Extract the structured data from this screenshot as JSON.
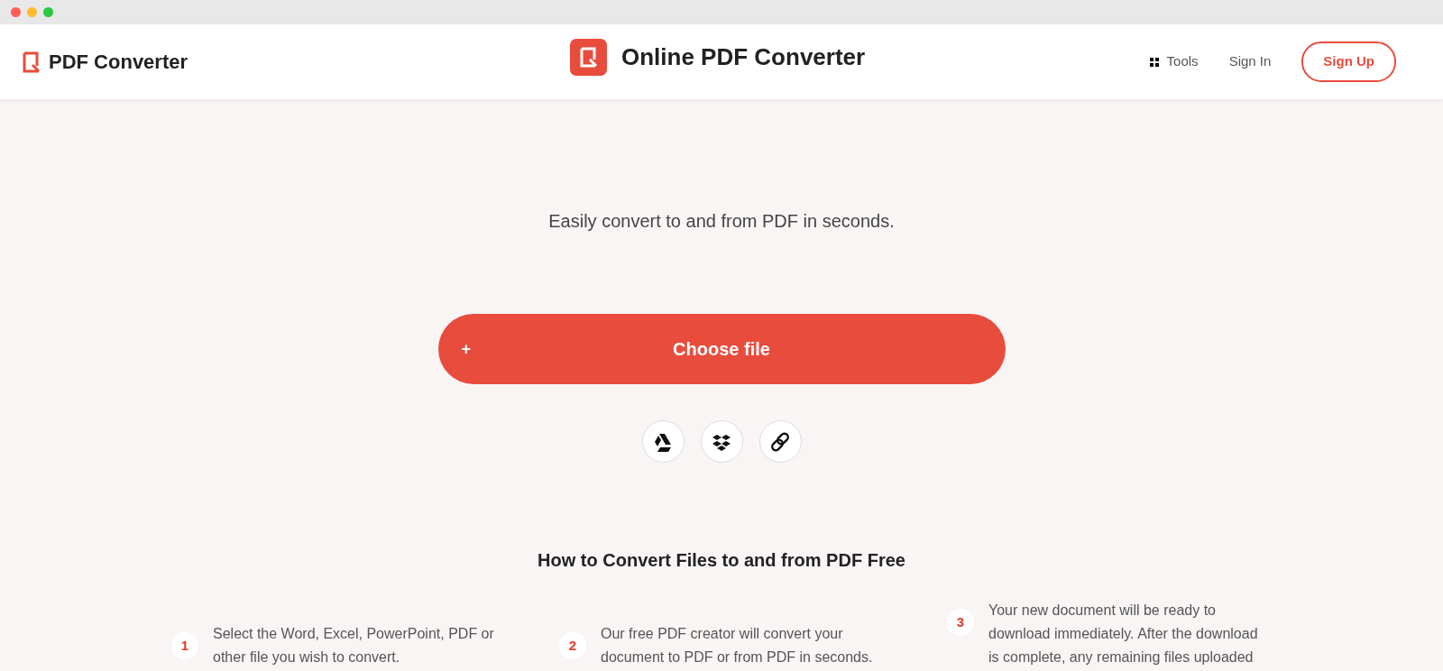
{
  "brand": {
    "name": "PDF Converter"
  },
  "header": {
    "title": "Online PDF Converter"
  },
  "nav": [
    {
      "label": "Tools",
      "kind": "menu"
    },
    {
      "label": "Sign In",
      "kind": "link"
    },
    {
      "label": "Sign Up",
      "kind": "button"
    }
  ],
  "tagline": "Easily convert to and from PDF in seconds.",
  "upload": {
    "icon": "+",
    "label": "Choose file"
  },
  "sources": [
    {
      "kind": "drive"
    },
    {
      "kind": "dropbox"
    },
    {
      "kind": "link"
    }
  ],
  "howto": {
    "title": "How to Convert Files to and from PDF Free",
    "steps": [
      {
        "number": "1",
        "text": "Select the Word, Excel, PowerPoint, PDF or other file you wish to convert."
      },
      {
        "number": "2",
        "text": "Our free PDF creator will convert your document to PDF or from PDF in seconds."
      },
      {
        "number": "3",
        "text": "Your new document will be ready to download immediately. After the download is complete, any remaining files uploaded"
      }
    ]
  }
}
